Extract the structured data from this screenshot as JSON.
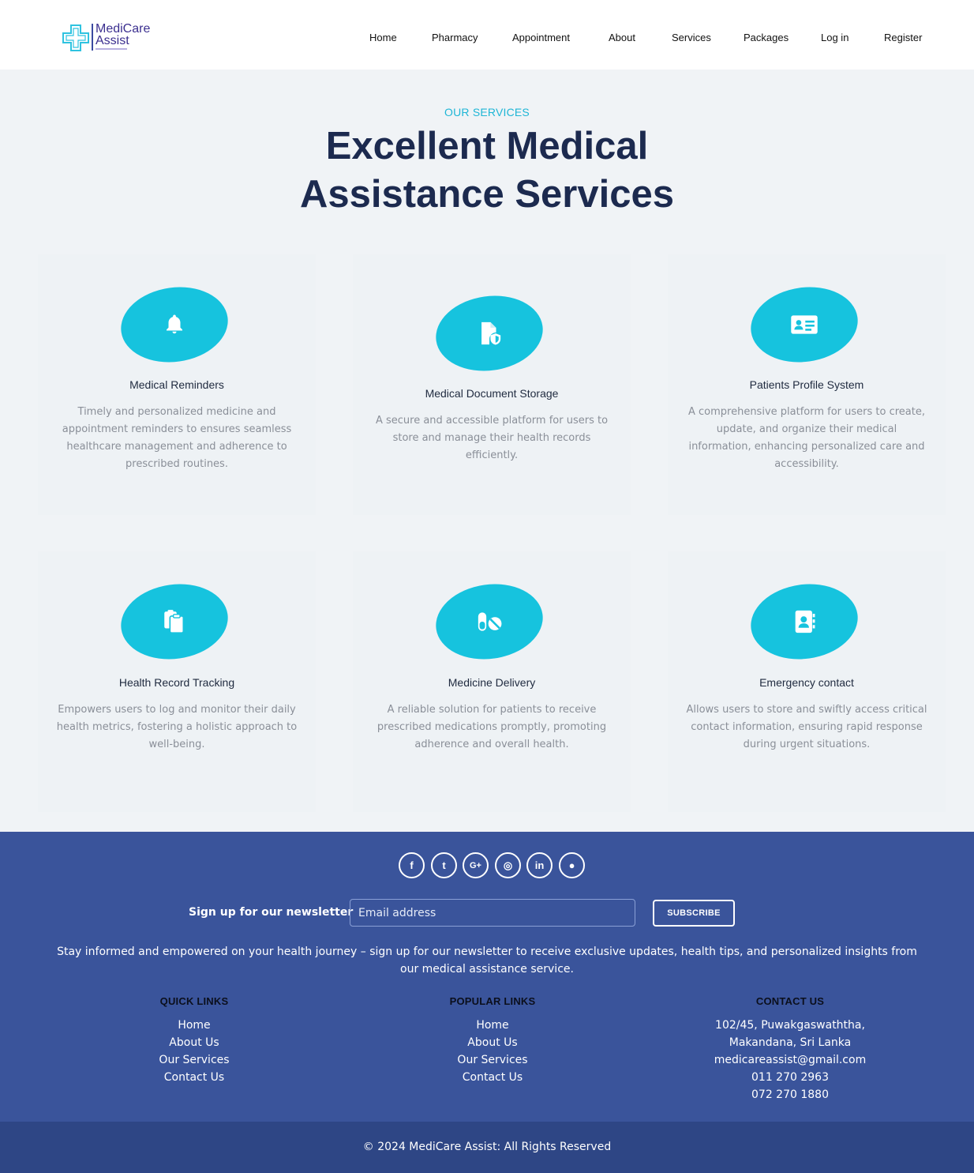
{
  "brand": {
    "line1": "MediCare",
    "line2": "Assist",
    "accent": "#16c3de"
  },
  "nav": [
    "Home",
    "Pharmacy",
    "Appointment",
    "About",
    "Services",
    "Packages",
    "Log in",
    "Register"
  ],
  "services_section": {
    "kicker": "OUR SERVICES",
    "title_line1": "Excellent Medical",
    "title_line2": "Assistance Services"
  },
  "services": [
    {
      "icon": "bell-icon",
      "title": "Medical Reminders",
      "description": "Timely and personalized medicine and appointment reminders to ensures seamless healthcare management and adherence to prescribed routines."
    },
    {
      "icon": "file-shield-icon",
      "title": "Medical Document Storage",
      "description": "A secure and accessible platform for users to store and manage their health records efficiently."
    },
    {
      "icon": "id-card-icon",
      "title": "Patients Profile System",
      "description": "A comprehensive platform for users to create, update, and organize their medical information, enhancing personalized care and accessibility."
    },
    {
      "icon": "clipboards-icon",
      "title": "Health Record Tracking",
      "description": "Empowers users to log and monitor their daily health metrics, fostering a holistic approach to well-being."
    },
    {
      "icon": "pills-icon",
      "title": "Medicine Delivery",
      "description": "A reliable solution for patients to receive prescribed medications promptly, promoting adherence and overall health."
    },
    {
      "icon": "contact-book-icon",
      "title": "Emergency contact",
      "description": "Allows users to store and swiftly access critical contact information, ensuring rapid response during urgent situations."
    }
  ],
  "footer": {
    "socials": [
      "facebook-icon",
      "twitter-icon",
      "google-plus-icon",
      "instagram-icon",
      "linkedin-icon",
      "github-icon"
    ],
    "social_glyphs": [
      "f",
      "t",
      "G+",
      "◎",
      "in",
      "●"
    ],
    "newsletter_label": "Sign up for our newsletter",
    "email_placeholder": "Email address",
    "subscribe_label": "SUBSCRIBE",
    "newsletter_desc": "Stay informed and empowered on your health journey – sign up for our newsletter to receive exclusive updates, health tips, and personalized insights from our medical assistance service.",
    "quick_links": {
      "heading": "QUICK LINKS",
      "items": [
        "Home",
        "About Us",
        "Our Services",
        "Contact Us"
      ]
    },
    "popular_links": {
      "heading": "POPULAR LINKS",
      "items": [
        "Home",
        "About Us",
        "Our Services",
        "Contact Us"
      ]
    },
    "contact": {
      "heading": "CONTACT US",
      "lines": [
        "102/45, Puwakgaswaththa,",
        "Makandana, Sri Lanka",
        "medicareassist@gmail.com",
        "011 270 2963",
        "072 270 1880"
      ]
    },
    "copyright": "© 2024 MediCare Assist: All Rights Reserved"
  }
}
